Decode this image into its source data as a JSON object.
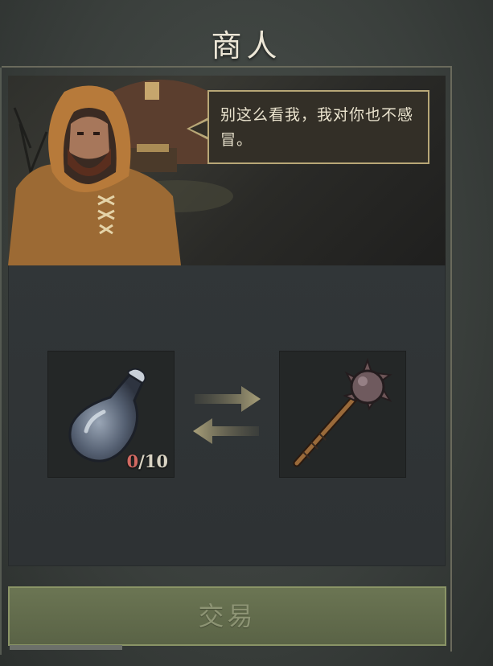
{
  "header": {
    "title": "商人"
  },
  "merchant": {
    "dialogue": "别这么看我，我对你也不感冒。"
  },
  "trade": {
    "give_item": {
      "icon": "potion-bottle-icon",
      "count_have": "0",
      "count_sep": "/",
      "count_need": "10"
    },
    "receive_item": {
      "icon": "spiked-mace-icon"
    },
    "button_label": "交易"
  },
  "colors": {
    "accent_gold": "#b8a777",
    "button_green": "#5a6346",
    "count_red": "#d26a62"
  }
}
